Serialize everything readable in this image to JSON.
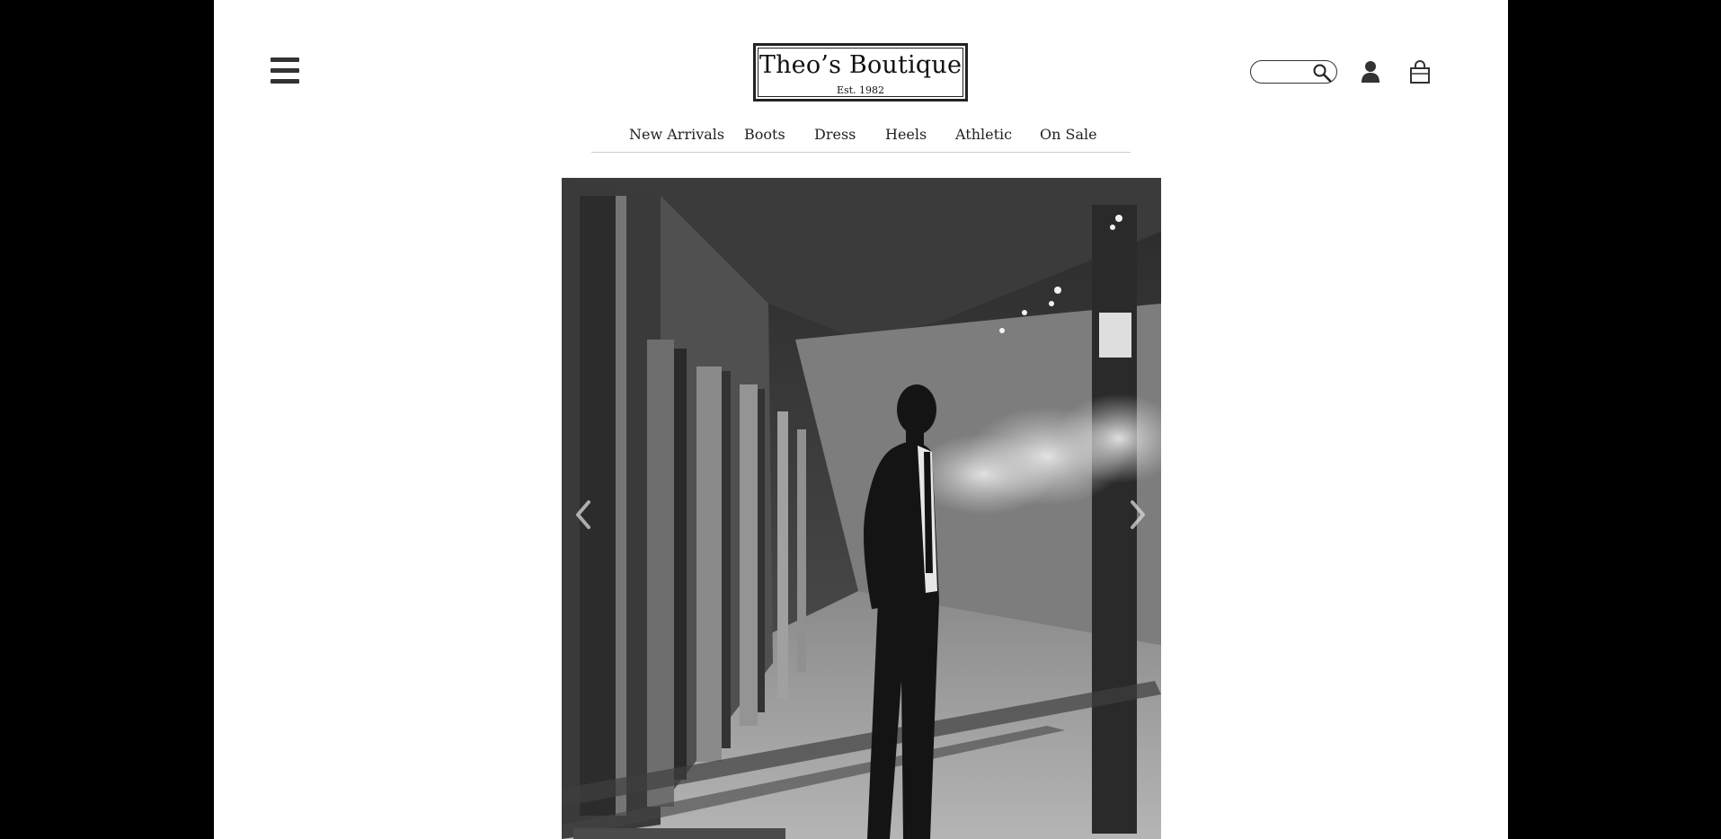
{
  "brand": {
    "name": "Theo’s Boutique",
    "established": "Est. 1982"
  },
  "header": {
    "menu_icon": "hamburger-icon",
    "search_icon": "magnifier-icon",
    "account_icon": "person-icon",
    "bag_icon": "shopping-bag-icon",
    "search_value": ""
  },
  "nav": {
    "items": [
      "New Arrivals",
      "Boots",
      "Dress",
      "Heels",
      "Athletic",
      "On Sale"
    ]
  },
  "hero": {
    "image": "black-and-white photo of man in suit standing under covered sidewalk",
    "prev_icon": "chevron-left-icon",
    "next_icon": "chevron-right-icon"
  },
  "colors": {
    "page_background": "#ffffff",
    "outer_background": "#000000",
    "text": "#222222"
  }
}
